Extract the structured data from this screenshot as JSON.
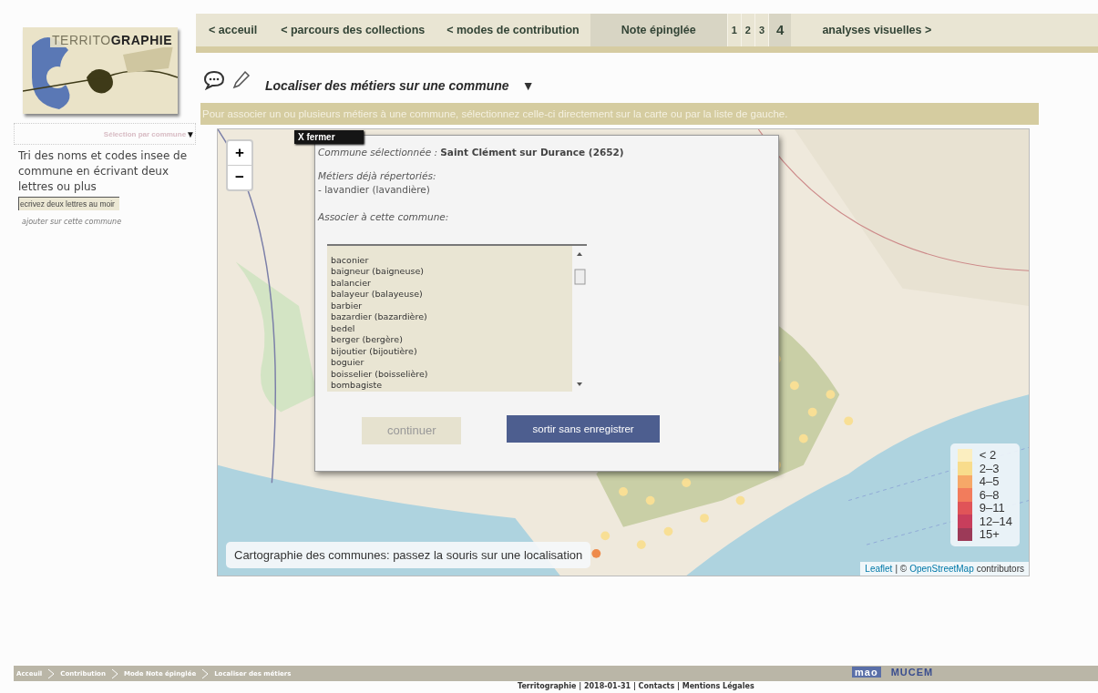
{
  "logo": {
    "title_light": "TERRITO",
    "title_bold": "GRAPHIE"
  },
  "nav": [
    {
      "label": "< acceuil",
      "selected": false
    },
    {
      "label": "< parcours des collections",
      "selected": false
    },
    {
      "label": "< modes de contribution",
      "selected": false
    },
    {
      "label": "Note épinglée",
      "selected": true
    }
  ],
  "pages": [
    {
      "label": "1",
      "selected": false
    },
    {
      "label": "2",
      "selected": false
    },
    {
      "label": "3",
      "selected": false
    },
    {
      "label": "4",
      "selected": true
    }
  ],
  "nav_next": "analyses visuelles >",
  "sidebar": {
    "selector": "Sélection par commune",
    "selector_caret": "▼",
    "help": "Tri des noms et codes insee de commune en écrivant deux lettres ou plus",
    "search": {
      "placeholder": "ecrivez deux lettres au moir"
    },
    "link": "ajouter sur cette commune"
  },
  "heading": {
    "title": "Localiser des métiers sur une commune",
    "caret": "▼"
  },
  "banner": "Pour associer un ou plusieurs métiers à une commune, sélectionnez celle-ci directement sur la carte ou par la liste de gauche.",
  "map": {
    "zoom_in": "+",
    "zoom_out": "−",
    "caption": "Cartographie des communes: passez la souris sur une localisation",
    "legend": [
      {
        "label": "< 2",
        "color": "#fbeec0"
      },
      {
        "label": "2–3",
        "color": "#f8dc8c"
      },
      {
        "label": "4–5",
        "color": "#f6a868"
      },
      {
        "label": "6–8",
        "color": "#f27c5c"
      },
      {
        "label": "9–11",
        "color": "#e05458"
      },
      {
        "label": "12–14",
        "color": "#c83e5c"
      },
      {
        "label": "15+",
        "color": "#9c3a58"
      }
    ],
    "attribution": {
      "leaflet": "Leaflet",
      "separator": "| ©",
      "osm": "OpenStreetMap",
      "rest": "contributors"
    }
  },
  "modal": {
    "close": "X fermer",
    "commune_label": "Commune sélectionnée :",
    "commune_value": "Saint Clément sur Durance (2652)",
    "existing_label": "Métiers déjà répertoriés:",
    "existing": [
      "- lavandier (lavandière)"
    ],
    "associate_label": "Associer à cette commune:",
    "options": [
      {
        "label": "baconier",
        "selected": false
      },
      {
        "label": "baigneur (baigneuse)",
        "selected": false
      },
      {
        "label": "balancier",
        "selected": false
      },
      {
        "label": "balayeur (balayeuse)",
        "selected": false
      },
      {
        "label": "barbier",
        "selected": false
      },
      {
        "label": "bazardier (bazardière)",
        "selected": false
      },
      {
        "label": "bedel",
        "selected": false
      },
      {
        "label": "berger (bergère)",
        "selected": false
      },
      {
        "label": "bijoutier (bijoutière)",
        "selected": false
      },
      {
        "label": "boguier",
        "selected": false
      },
      {
        "label": "boisselier (boisselière)",
        "selected": false
      },
      {
        "label": "bombagiste",
        "selected": false
      }
    ],
    "buttons": [
      {
        "label": "continuer",
        "disabled": true
      },
      {
        "label": "sortir sans enregistrer",
        "disabled": false
      }
    ]
  },
  "breadcrumb": [
    "Acceuil",
    "Contribution",
    "Mode Note épinglée",
    "Localiser des métiers"
  ],
  "partner_logos": [
    "mao",
    "MUCEM"
  ],
  "footer": "Territographie | 2018-01-31 | Contacts | Mentions Légales"
}
